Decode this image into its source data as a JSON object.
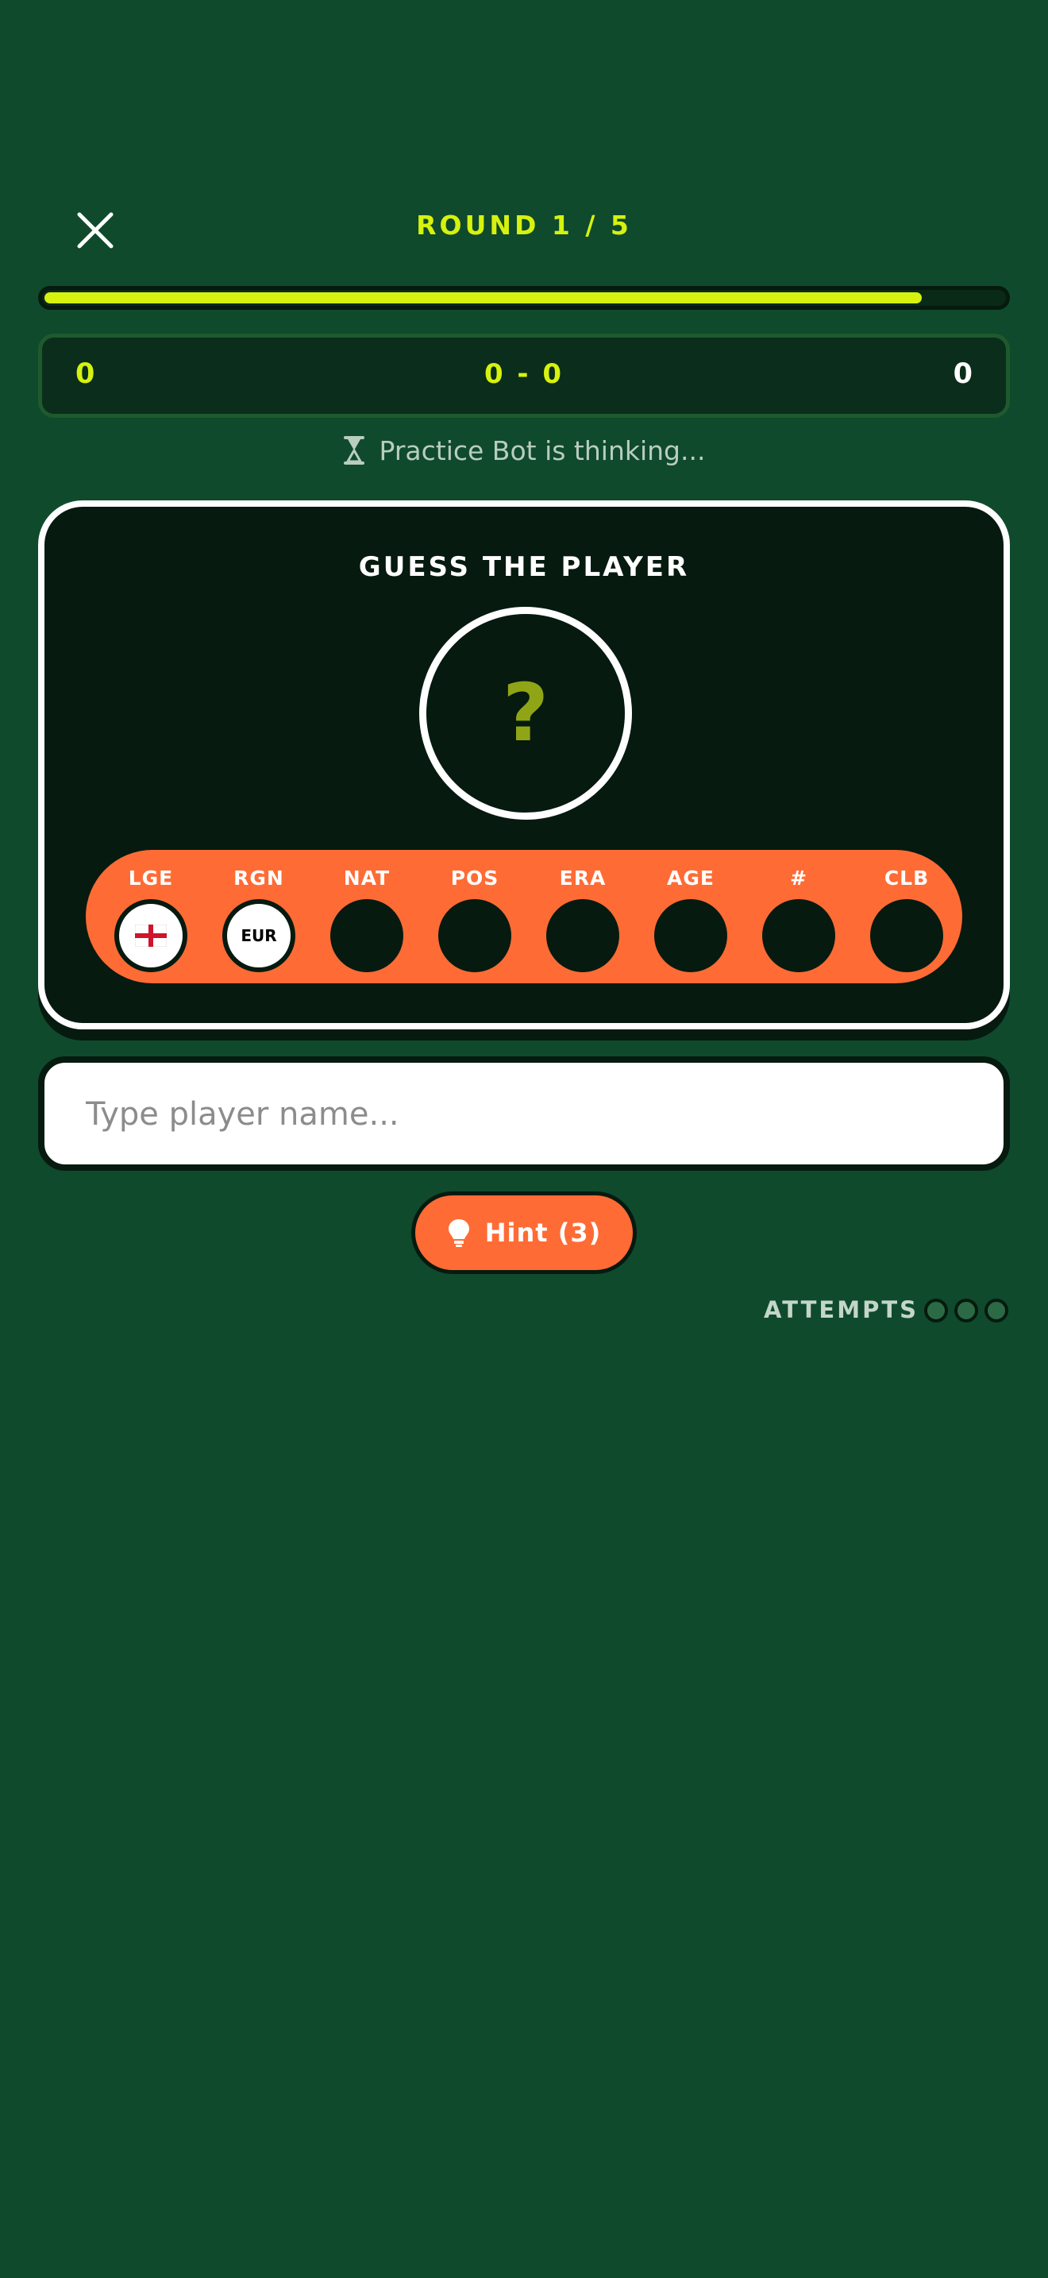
{
  "header": {
    "close_icon": "close-icon",
    "round_label": "ROUND 1 / 5"
  },
  "progress": {
    "fraction": 0.915,
    "fill_color": "#d6f20e"
  },
  "score": {
    "left": "0",
    "middle": "0 - 0",
    "right": "0"
  },
  "status": {
    "icon": "hourglass-icon",
    "text": "Practice Bot is thinking..."
  },
  "card": {
    "title": "GUESS THE PLAYER",
    "mystery_symbol": "?",
    "attributes": [
      {
        "label": "LGE",
        "revealed": true,
        "icon": "england-flag-icon"
      },
      {
        "label": "RGN",
        "revealed": true,
        "value": "EUR"
      },
      {
        "label": "NAT",
        "revealed": false
      },
      {
        "label": "POS",
        "revealed": false
      },
      {
        "label": "ERA",
        "revealed": false
      },
      {
        "label": "AGE",
        "revealed": false
      },
      {
        "label": "#",
        "revealed": false
      },
      {
        "label": "CLB",
        "revealed": false
      }
    ]
  },
  "input": {
    "placeholder": "Type player name...",
    "value": ""
  },
  "hint": {
    "icon": "lightbulb-icon",
    "label": "Hint (3)"
  },
  "attempts": {
    "label": "ATTEMPTS",
    "total": 3,
    "used": 0
  },
  "colors": {
    "background": "#0f4a2c",
    "accent_lime": "#d6f20e",
    "accent_orange": "#ff6b35",
    "card_dark": "#061a0f"
  }
}
